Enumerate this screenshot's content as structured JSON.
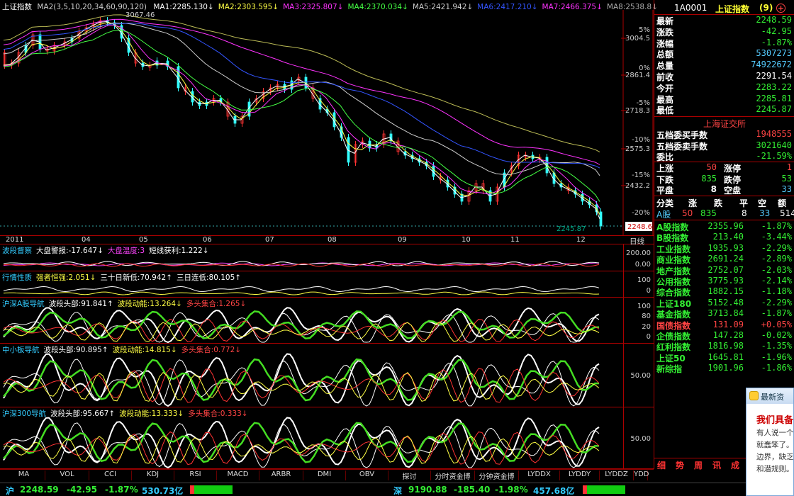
{
  "title_bar": {
    "name": "上证指数",
    "ma_params": "MA2(3,5,10,20,34,60,90,120)",
    "ma_values": [
      {
        "label": "MA1:2285.130",
        "color": "#ffffff"
      },
      {
        "label": "MA2:2303.595",
        "color": "#ffff44"
      },
      {
        "label": "MA3:2325.807",
        "color": "#ff33ff"
      },
      {
        "label": "MA4:2370.034",
        "color": "#44ff44"
      },
      {
        "label": "MA5:2421.942",
        "color": "#cccccc"
      },
      {
        "label": "MA6:2417.210",
        "color": "#3355ff"
      },
      {
        "label": "MA7:2466.375",
        "color": "#ff33ff"
      },
      {
        "label": "MA8:2538.8",
        "color": "#aaaaaa"
      }
    ],
    "down_arrow": "↓"
  },
  "main_chart": {
    "high_label": "3067.46",
    "last_label": "2245.87",
    "last_tag": "2248.6",
    "price_axis": [
      "3004.5",
      "2861.4",
      "2718.3",
      "2575.3",
      "2432.2"
    ],
    "pct_axis": [
      "5%",
      "0%",
      "-5%",
      "-10%",
      "-15%",
      "-20%"
    ],
    "months": [
      "2011",
      "04",
      "05",
      "06",
      "07",
      "08",
      "09",
      "10",
      "11",
      "12"
    ],
    "period": "日线"
  },
  "panels": [
    {
      "name": "波段督察",
      "items": [
        {
          "t": "大盘警报:-17.647↓",
          "c": "#ffffff"
        },
        {
          "t": "大盘温度:3",
          "c": "#ff44ff"
        },
        {
          "t": "短线获利:1.222↓",
          "c": "#ffffff"
        }
      ],
      "axis": [
        "200.00",
        "0.00"
      ]
    },
    {
      "name": "行情性质",
      "items": [
        {
          "t": "强者恒强:2.051↓",
          "c": "#ffff44"
        },
        {
          "t": "三十日新低:70.942↑",
          "c": "#ffffff"
        },
        {
          "t": "三日连低:80.105↑",
          "c": "#ffffff"
        }
      ],
      "axis": [
        "100",
        "0"
      ]
    },
    {
      "name": "沪深A股导航",
      "items": [
        {
          "t": "波段头部:91.841↑",
          "c": "#ffffff"
        },
        {
          "t": "波段动能:13.264↓",
          "c": "#ffff44"
        },
        {
          "t": "多头集合:1.265↓",
          "c": "#ff4444"
        }
      ],
      "axis": [
        "100",
        "80",
        "20",
        "0"
      ]
    },
    {
      "name": "中小板导航",
      "items": [
        {
          "t": "波段头部:90.895↑",
          "c": "#ffffff"
        },
        {
          "t": "波段动能:14.815↓",
          "c": "#ffff44"
        },
        {
          "t": "多头集合:0.772↓",
          "c": "#ff4444"
        }
      ],
      "axis": [
        "50.00"
      ]
    },
    {
      "name": "沪深300导航",
      "items": [
        {
          "t": "波段头部:95.667↑",
          "c": "#ffffff"
        },
        {
          "t": "波段动能:13.333↓",
          "c": "#ffff44"
        },
        {
          "t": "多头集合:0.333↓",
          "c": "#ff4444"
        }
      ],
      "axis": [
        "50.00"
      ]
    }
  ],
  "quote": {
    "code": "1A0001",
    "name": "上证指数",
    "suffix": "(9)",
    "rows": [
      {
        "k": "最新",
        "v": "2248.59",
        "c": "green"
      },
      {
        "k": "涨跌",
        "v": "-42.95",
        "c": "green"
      },
      {
        "k": "涨幅",
        "v": "-1.87%",
        "c": "green"
      },
      {
        "k": "总额",
        "v": "5307273",
        "c": "cyan"
      },
      {
        "k": "总量",
        "v": "74922672",
        "c": "cyan"
      },
      {
        "k": "前收",
        "v": "2291.54",
        "c": "white"
      },
      {
        "k": "今开",
        "v": "2283.22",
        "c": "green"
      },
      {
        "k": "最高",
        "v": "2285.81",
        "c": "green"
      },
      {
        "k": "最低",
        "v": "2245.87",
        "c": "green"
      }
    ],
    "exchange": "上海证交所",
    "orders": [
      {
        "k": "五档委买手数",
        "v": "1948555",
        "c": "red"
      },
      {
        "k": "五档委卖手数",
        "v": "3021640",
        "c": "green"
      },
      {
        "k": "委比",
        "v": "-21.59%",
        "c": "green"
      }
    ],
    "breadth": [
      {
        "a": "上涨",
        "av": "50",
        "ac": "red",
        "b": "涨停",
        "bv": "1",
        "bc": "red"
      },
      {
        "a": "下跌",
        "av": "835",
        "ac": "green",
        "b": "跌停",
        "bv": "53",
        "bc": "green"
      },
      {
        "a": "平盘",
        "av": "8",
        "ac": "white",
        "b": "空盘",
        "bv": "33",
        "bc": "cyan"
      }
    ],
    "class_header": [
      "分类",
      "涨",
      "跌",
      "平",
      "空",
      "额"
    ],
    "class_row": {
      "name": "A股",
      "up": "50",
      "down": "835",
      "flat": "8",
      "empty": "33",
      "amt": "514"
    },
    "indices": [
      {
        "n": "A股指数",
        "v": "2355.96",
        "p": "-1.87%",
        "c": "green"
      },
      {
        "n": "B股指数",
        "v": "213.40",
        "p": "-3.44%",
        "c": "green"
      },
      {
        "n": "工业指数",
        "v": "1935.93",
        "p": "-2.29%",
        "c": "green"
      },
      {
        "n": "商业指数",
        "v": "2691.24",
        "p": "-2.89%",
        "c": "green"
      },
      {
        "n": "地产指数",
        "v": "2752.07",
        "p": "-2.03%",
        "c": "green"
      },
      {
        "n": "公用指数",
        "v": "3775.93",
        "p": "-2.14%",
        "c": "green"
      },
      {
        "n": "综合指数",
        "v": "1882.15",
        "p": "-1.18%",
        "c": "green"
      },
      {
        "n": "上证180",
        "v": "5152.48",
        "p": "-2.29%",
        "c": "green"
      },
      {
        "n": "基金指数",
        "v": "3713.84",
        "p": "-1.87%",
        "c": "green"
      },
      {
        "n": "国债指数",
        "v": "131.09",
        "p": "+0.05%",
        "c": "red"
      },
      {
        "n": "企债指数",
        "v": "147.28",
        "p": "-0.02%",
        "c": "green"
      },
      {
        "n": "红利指数",
        "v": "1816.98",
        "p": "-1.35%",
        "c": "green"
      },
      {
        "n": "上证50",
        "v": "1645.81",
        "p": "-1.96%",
        "c": "green"
      },
      {
        "n": "新综指",
        "v": "1901.96",
        "p": "-1.86%",
        "c": "green"
      }
    ],
    "side_tabs": [
      "细",
      "势",
      "周",
      "讯",
      "成"
    ]
  },
  "bottom_tabs": [
    "MA",
    "VOL",
    "CCI",
    "KDJ",
    "RSI",
    "MACD",
    "ARBR",
    "DMI",
    "OBV",
    "探讨",
    "分时资金博",
    "分钟资金博",
    "LYDDX",
    "LYDDY",
    "LYDDZ",
    "YDD"
  ],
  "status_bar": {
    "sh_label": "沪",
    "sh_value": "2248.59",
    "sh_change": "-42.95",
    "sh_pct": "-1.87%",
    "sh_amount": "530.73亿",
    "sz_label": "深",
    "sz_value": "9190.88",
    "sz_change": "-185.40",
    "sz_pct": "-1.98%",
    "sz_amount": "457.68亿"
  },
  "popup": {
    "header": "最新资",
    "title": "我们具备",
    "lines": [
      "有人说一个",
      "就蠢笨了。",
      "边界，缺乏",
      "和潜规则。"
    ]
  }
}
